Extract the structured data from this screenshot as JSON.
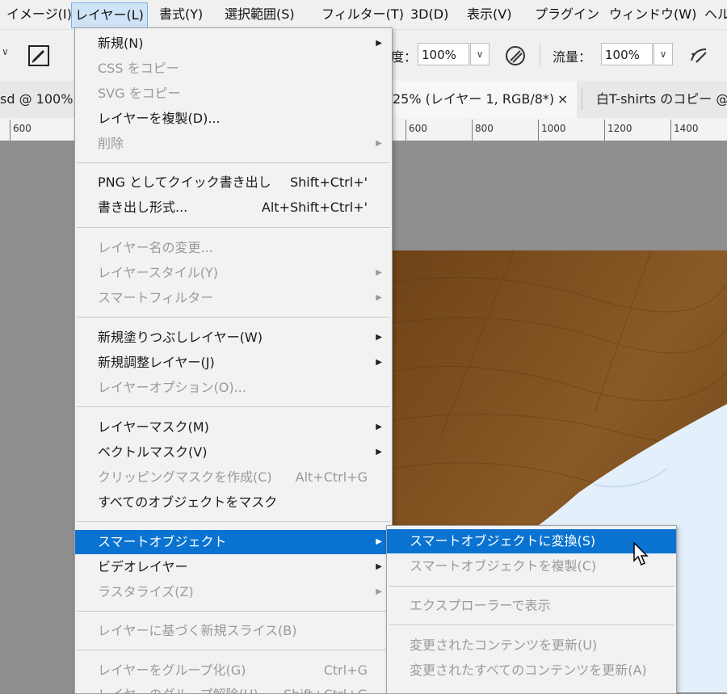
{
  "menubar": {
    "items": [
      {
        "label": "イメージ(I)"
      },
      {
        "label": "レイヤー(L)"
      },
      {
        "label": "書式(Y)"
      },
      {
        "label": "選択範囲(S)"
      },
      {
        "label": "フィルター(T)"
      },
      {
        "label": "3D(D)"
      },
      {
        "label": "表示(V)"
      },
      {
        "label": "プラグイン"
      },
      {
        "label": "ウィンドウ(W)"
      },
      {
        "label": "ヘル"
      }
    ]
  },
  "options": {
    "opacity_label": "度：",
    "opacity_value": "100%",
    "flow_label": "流量：",
    "flow_value": "100%"
  },
  "tabs": [
    {
      "label": "sd @ 100%"
    },
    {
      "label": "25% (レイヤー 1, RGB/8*)"
    },
    {
      "label": "×"
    },
    {
      "label": "白T-shirts のコピー @"
    }
  ],
  "ruler": {
    "ticks": [
      "600",
      "600",
      "800",
      "1000",
      "1200",
      "1400"
    ]
  },
  "layer_menu": {
    "new": "新規(N)",
    "copy_css": "CSS をコピー",
    "copy_svg": "SVG をコピー",
    "duplicate": "レイヤーを複製(D)...",
    "delete": "削除",
    "quick_export": "PNG としてクイック書き出し",
    "quick_export_sc": "Shift+Ctrl+'",
    "export_as": "書き出し形式...",
    "export_as_sc": "Alt+Shift+Ctrl+'",
    "rename": "レイヤー名の変更...",
    "layer_style": "レイヤースタイル(Y)",
    "smart_filter": "スマートフィルター",
    "new_fill": "新規塗りつぶしレイヤー(W)",
    "new_adjust": "新規調整レイヤー(J)",
    "layer_options": "レイヤーオプション(O)...",
    "layer_mask": "レイヤーマスク(M)",
    "vector_mask": "ベクトルマスク(V)",
    "clip_mask": "クリッピングマスクを作成(C)",
    "clip_mask_sc": "Alt+Ctrl+G",
    "mask_all": "すべてのオブジェクトをマスク",
    "smart_object": "スマートオブジェクト",
    "video_layer": "ビデオレイヤー",
    "rasterize": "ラスタライズ(Z)",
    "new_slice": "レイヤーに基づく新規スライス(B)",
    "group": "レイヤーをグループ化(G)",
    "group_sc": "Ctrl+G",
    "ungroup": "レイヤーのグループ解除(U)",
    "ungroup_sc": "Shift+Ctrl+G",
    "arrow": "▶"
  },
  "smart_menu": {
    "convert": "スマートオブジェクトに変換(S)",
    "duplicate": "スマートオブジェクトを複製(C)",
    "show_explorer": "エクスプローラーで表示",
    "update_modified": "変更されたコンテンツを更新(U)",
    "update_all": "変更されたすべてのコンテンツを更新(A)"
  }
}
